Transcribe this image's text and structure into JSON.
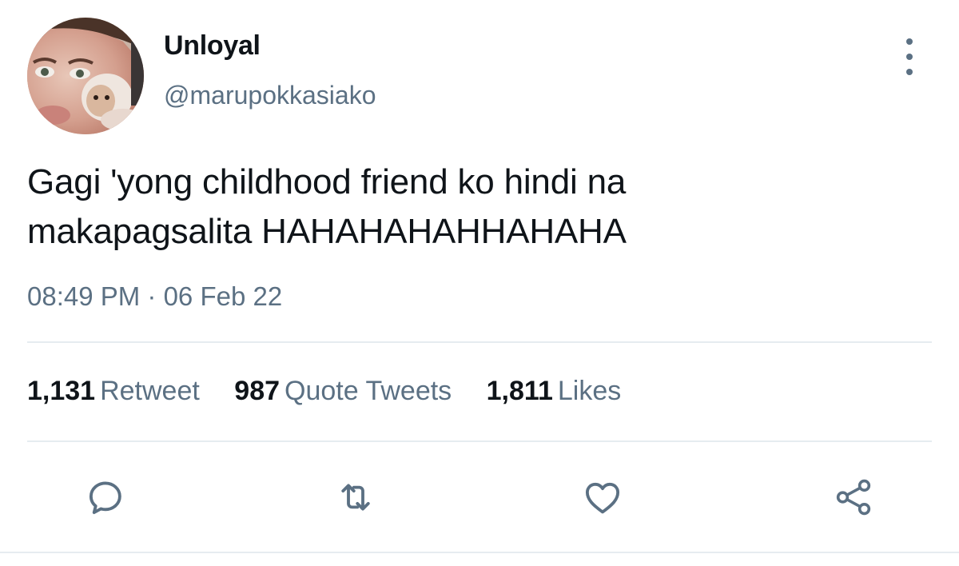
{
  "author": {
    "display_name": "Unloyal",
    "handle": "@marupokkasiako"
  },
  "tweet": {
    "text_lines": [
      "Gagi 'yong childhood friend ko hindi na",
      "makapagsalita HAHAHAHAHHAHAHA"
    ],
    "timestamp": "08:49 PM · 06 Feb 22"
  },
  "stats": {
    "retweets": {
      "count": "1,131",
      "label": "Retweet"
    },
    "quotes": {
      "count": "987",
      "label": "Quote Tweets"
    },
    "likes": {
      "count": "1,811",
      "label": "Likes"
    }
  },
  "actions": [
    {
      "icon": "reply-icon"
    },
    {
      "icon": "retweet-icon"
    },
    {
      "icon": "like-icon"
    },
    {
      "icon": "share-icon"
    }
  ],
  "colors": {
    "text_primary": "#0f1419",
    "text_secondary": "#5b7083",
    "divider": "#e6ecf0"
  }
}
